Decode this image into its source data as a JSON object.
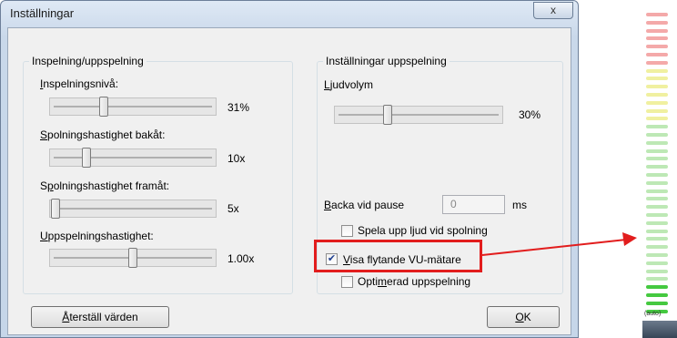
{
  "dialog": {
    "title": "Inställningar",
    "close_label": "x"
  },
  "left_group": {
    "label": "Inspelning/uppspelning",
    "recording_level": {
      "label_u": "I",
      "label_rest": "nspelningsnivå:",
      "value_text": "31%",
      "value": 0.31
    },
    "rewind_speed": {
      "label_u": "S",
      "label_rest": "polningshastighet bakåt:",
      "value_text": "10x",
      "value": 0.2
    },
    "forward_speed": {
      "label_pre": "S",
      "label_u": "p",
      "label_rest": "olningshastighet framåt:",
      "value_text": "5x",
      "value": 0.0
    },
    "playback_speed": {
      "label_u": "U",
      "label_rest": "ppspelningshastighet:",
      "value_text": "1.00x",
      "value": 0.5
    }
  },
  "right_group": {
    "label": "Inställningar uppspelning",
    "volume": {
      "label_u": "L",
      "label_rest": "judvolym",
      "value_text": "30%",
      "value": 0.3
    },
    "pause_rewind": {
      "label_u": "B",
      "label_rest": "acka vid pause",
      "value": "0",
      "unit": "ms"
    },
    "play_sound_on_seek": {
      "label": "Spela upp ljud vid spolning",
      "checked": false
    },
    "floating_vu": {
      "label_u": "V",
      "label_rest": "isa flytande VU-mätare",
      "checked": true
    },
    "optimized_playback": {
      "label_pre": "Opti",
      "label_u": "m",
      "label_rest": "erad uppspelning",
      "checked": false
    }
  },
  "buttons": {
    "reset": {
      "label_u": "Å",
      "label_rest": "terställ värden"
    },
    "ok": {
      "label_u": "O",
      "label_rest": "K"
    }
  },
  "annotation": {
    "color": "#e21d1d"
  },
  "vu_meter": {
    "text": "(auto)",
    "colors": {
      "red": "#f4a9a9",
      "yellow": "#f0f0a0",
      "green_light": "#bde8b5",
      "green_dark": "#45c940"
    }
  }
}
